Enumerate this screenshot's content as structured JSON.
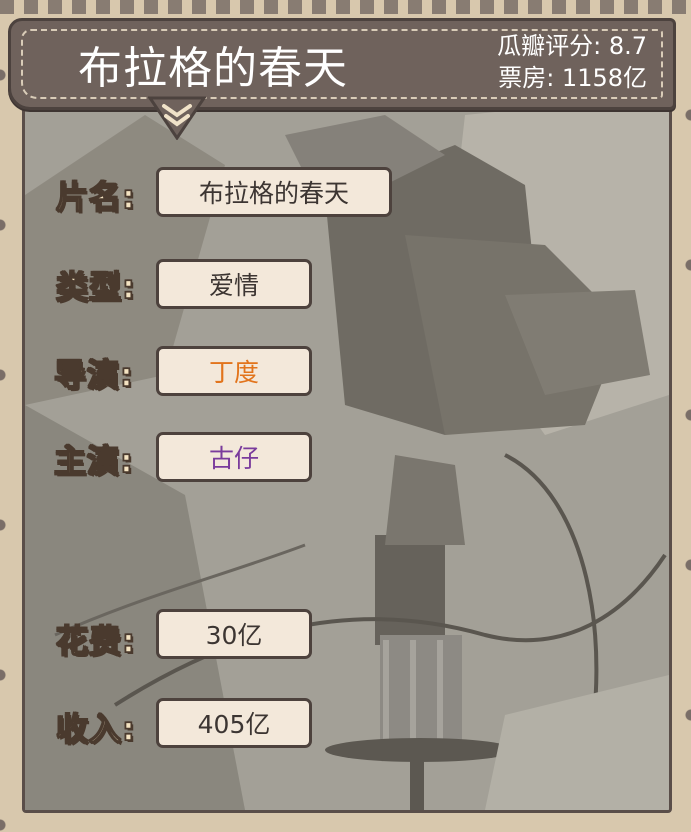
{
  "header": {
    "title": "布拉格的春天",
    "score_label": "瓜瓣评分",
    "score_value": "8.7",
    "boxoffice_label": "票房",
    "boxoffice_value": "1158亿"
  },
  "fields": [
    {
      "label": "片名",
      "value": "布拉格的春天"
    },
    {
      "label": "类型",
      "value": "爱情"
    },
    {
      "label": "导演",
      "value": "丁度"
    },
    {
      "label": "主演",
      "value": "古仔"
    },
    {
      "label": "花费",
      "value": "30亿"
    },
    {
      "label": "收入",
      "value": "405亿"
    }
  ],
  "colors": {
    "director_value": "#e2741c",
    "actor_value": "#7a3b9c",
    "banner": "#6f625c",
    "label_fill": "#f4e3c2"
  }
}
